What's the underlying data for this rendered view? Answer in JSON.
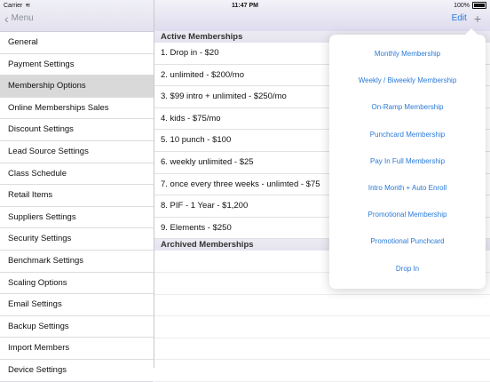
{
  "statusbar": {
    "carrier": "Carrier",
    "time": "11:47 PM",
    "battery": "100%"
  },
  "sidebar": {
    "back_label": "Menu",
    "items": [
      {
        "label": "General"
      },
      {
        "label": "Payment Settings"
      },
      {
        "label": "Membership Options"
      },
      {
        "label": "Online Memberships Sales"
      },
      {
        "label": "Discount Settings"
      },
      {
        "label": "Lead Source Settings"
      },
      {
        "label": "Class Schedule"
      },
      {
        "label": "Retail Items"
      },
      {
        "label": "Suppliers Settings"
      },
      {
        "label": "Security Settings"
      },
      {
        "label": "Benchmark Settings"
      },
      {
        "label": "Scaling Options"
      },
      {
        "label": "Email Settings"
      },
      {
        "label": "Backup Settings"
      },
      {
        "label": "Import Members"
      },
      {
        "label": "Device Settings"
      }
    ],
    "selected_index": 2
  },
  "main": {
    "edit_label": "Edit",
    "active_header": "Active Memberships",
    "active": [
      "1. Drop in - $20",
      "2. unlimited - $200/mo",
      "3. $99 intro + unlimited - $250/mo",
      "4. kids - $75/mo",
      "5. 10 punch - $100",
      "6. weekly unlimited - $25",
      "7. once every three weeks - unlimted - $75",
      "8. PIF - 1 Year - $1,200",
      "9. Elements - $250"
    ],
    "archived_header": "Archived Memberships"
  },
  "popover": {
    "items": [
      "Monthly Membership",
      "Weekly / Biweekly Membership",
      "On-Ramp Membership",
      "Punchcard Membership",
      "Pay In Full Membership",
      "Intro Month + Auto Enroll",
      "Promotional Membership",
      "Promotional Punchcard",
      "Drop In"
    ]
  },
  "colors": {
    "accent": "#2a7ad6",
    "selected_row": "#d9d9d9"
  }
}
